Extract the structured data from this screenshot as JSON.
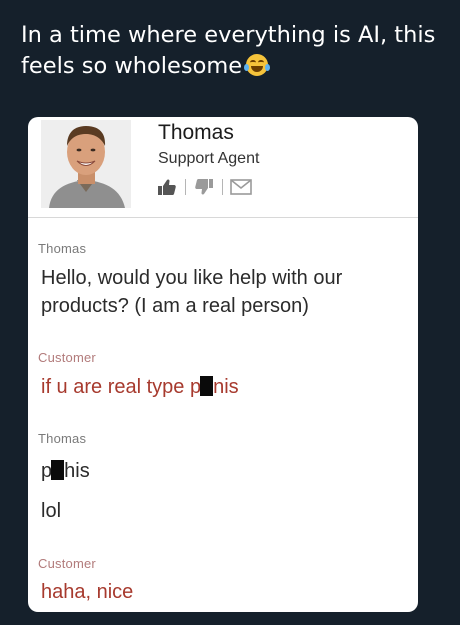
{
  "tweet": {
    "line1": "In a time where everything is AI, this",
    "line2": "feels so wholesome",
    "emoji": "face-with-tears-of-joy"
  },
  "agent": {
    "name": "Thomas",
    "role": "Support Agent",
    "actions": [
      "thumbs-up-icon",
      "thumbs-down-icon",
      "envelope-icon"
    ]
  },
  "messages": [
    {
      "sender": "Thomas",
      "lines": [
        "Hello, would you like help with our",
        "products? (I am a real person)"
      ]
    },
    {
      "sender": "Customer",
      "text_before": "if u are real type p",
      "text_after": "nis"
    },
    {
      "sender": "Thomas",
      "text_before": "p",
      "text_after": "his",
      "line2": "lol"
    },
    {
      "sender": "Customer",
      "text": "haha, nice"
    }
  ],
  "colors": {
    "background": "#15202b",
    "card": "#ffffff",
    "customer_text": "#a73a2e",
    "agent_text": "#2b2b2b"
  }
}
